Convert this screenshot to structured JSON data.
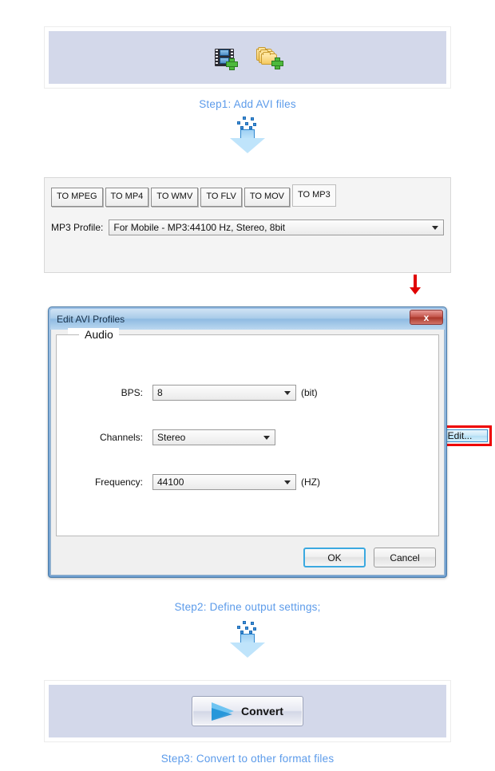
{
  "page": {
    "background": "#ffffff",
    "accent_step_color": "#5c9bea",
    "panel_fill": "#d3d8ea",
    "highlight_color": "#ee0000"
  },
  "step1": {
    "caption": "Step1: Add  AVI  files",
    "icons": [
      {
        "name": "add-video-file-icon",
        "title": "Add video files"
      },
      {
        "name": "add-folder-icon",
        "title": "Add folder"
      }
    ]
  },
  "arrow1": {
    "name": "dissolve-down-arrow",
    "color": "#3e8fd8"
  },
  "converter": {
    "tabs": [
      {
        "label": "TO MPEG",
        "active": false
      },
      {
        "label": "TO MP4",
        "active": false
      },
      {
        "label": "TO WMV",
        "active": false
      },
      {
        "label": "TO FLV",
        "active": false
      },
      {
        "label": "TO MOV",
        "active": false
      },
      {
        "label": "TO MP3",
        "active": true
      }
    ],
    "profile_label": "MP3 Profile:",
    "profile_value": "For Mobile - MP3:44100 Hz, Stereo, 8bit",
    "edit_label": "Edit..."
  },
  "dialog": {
    "title": "Edit AVI Profiles",
    "close_label": "x",
    "group_legend": "Audio",
    "fields": [
      {
        "label": "BPS:",
        "value": "8",
        "unit": "(bit)",
        "name": "bps"
      },
      {
        "label": "Channels:",
        "value": "Stereo",
        "unit": "",
        "name": "channels"
      },
      {
        "label": "Frequency:",
        "value": "44100",
        "unit": "(HZ)",
        "name": "frequency"
      }
    ],
    "ok_label": "OK",
    "cancel_label": "Cancel"
  },
  "step2": {
    "caption": "Step2: Define output settings;"
  },
  "arrow2": {
    "name": "dissolve-down-arrow",
    "color": "#3e8fd8"
  },
  "step3": {
    "caption": "Step3: Convert to other format files",
    "convert_label": "Convert"
  }
}
